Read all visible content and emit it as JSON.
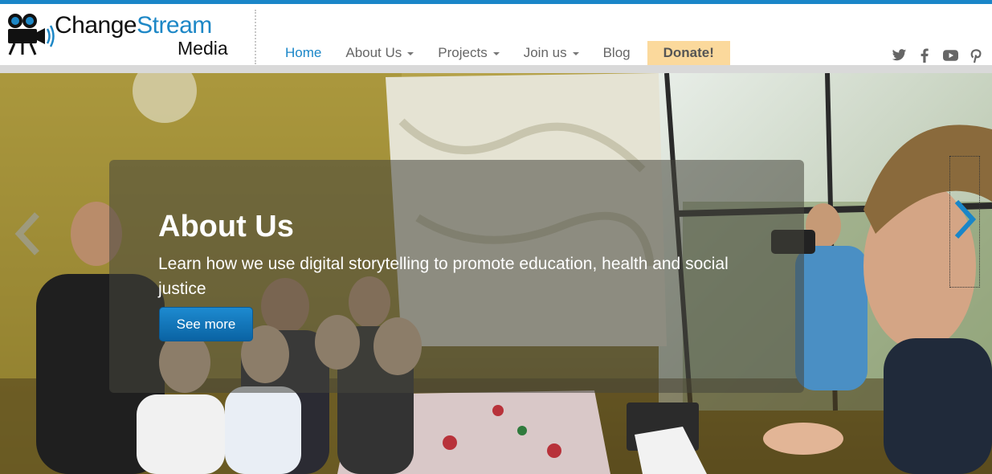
{
  "brand": {
    "name_part1": "Change",
    "name_part2": "Stream",
    "subtitle": "Media",
    "logo_icon": "film-camera-icon",
    "accent_color": "#1a86c8"
  },
  "nav": {
    "items": [
      {
        "label": "Home",
        "active": true,
        "dropdown": false
      },
      {
        "label": "About Us",
        "active": false,
        "dropdown": true
      },
      {
        "label": "Projects",
        "active": false,
        "dropdown": true
      },
      {
        "label": "Join us",
        "active": false,
        "dropdown": true
      },
      {
        "label": "Blog",
        "active": false,
        "dropdown": false
      }
    ],
    "donate_label": "Donate!",
    "donate_color": "#fbd99c"
  },
  "social": [
    "twitter-icon",
    "facebook-icon",
    "youtube-icon",
    "pinterest-icon"
  ],
  "hero": {
    "title": "About Us",
    "text": "Learn how we use digital storytelling to promote education, health and social justice",
    "button_label": "See more",
    "prev_icon": "chevron-left-icon",
    "next_icon": "chevron-right-icon"
  }
}
